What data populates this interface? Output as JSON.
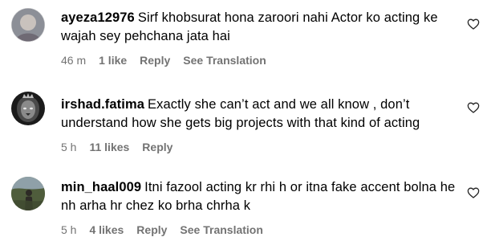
{
  "comments": [
    {
      "username": "ayeza12976",
      "text": "Sirf khobsurat hona zaroori nahi Actor ko acting ke wajah sey pehchana jata hai",
      "time": "46 m",
      "likes": "1 like",
      "reply": "Reply",
      "translation": "See Translation",
      "avatar_icon": "default-profile-avatar-icon"
    },
    {
      "username": "irshad.fatima",
      "text": "Exactly she can’t act and we all know , don’t understand how she gets big projects with that kind of acting",
      "time": "5 h",
      "likes": "11 likes",
      "reply": "Reply",
      "avatar_icon": "lion-avatar-icon"
    },
    {
      "username": "min_haal009",
      "text": "Itni fazool acting kr rhi h or itna fake accent bolna he nh arha hr chez ko brha chrha k",
      "time": "5 h",
      "likes": "4 likes",
      "reply": "Reply",
      "translation": "See Translation",
      "avatar_icon": "outdoor-photo-avatar-icon"
    }
  ],
  "icons": {
    "like": "heart-outline-icon"
  },
  "colors": {
    "meta": "#737373",
    "text": "#000000",
    "background": "#ffffff"
  }
}
